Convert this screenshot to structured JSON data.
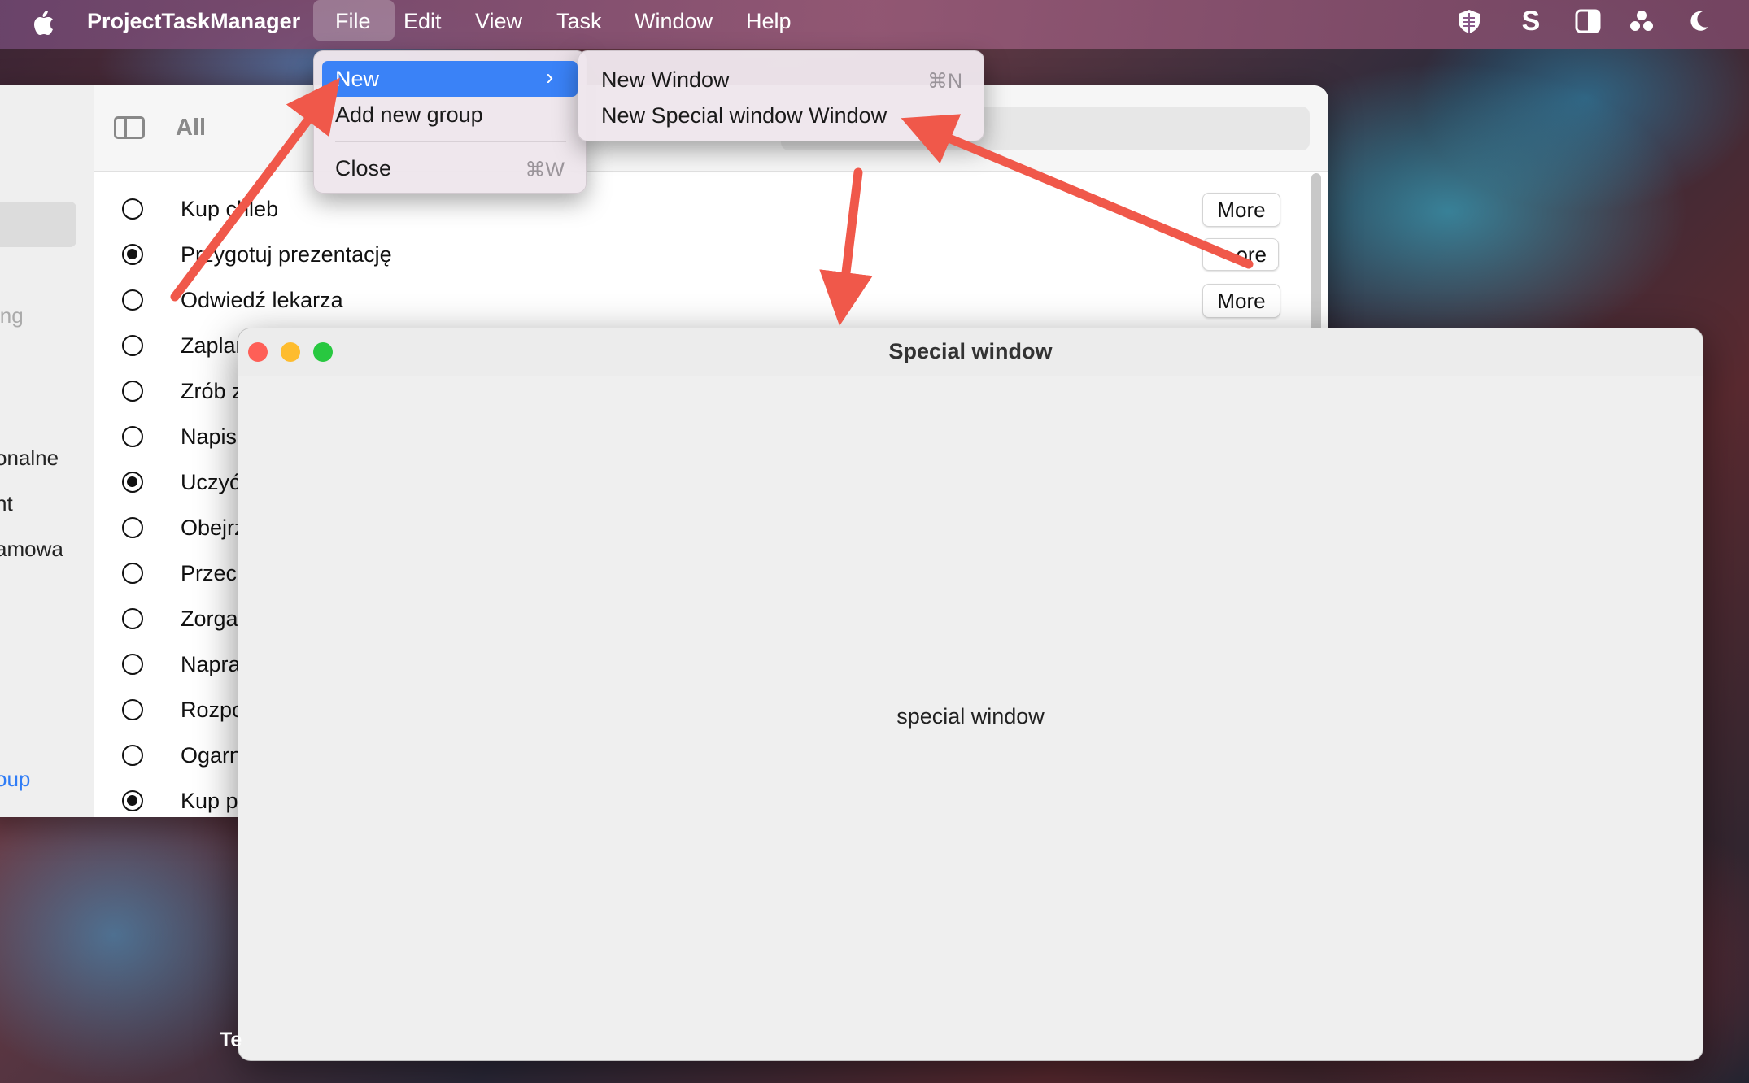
{
  "menubar": {
    "app_name": "ProjectTaskManager",
    "items": [
      "File",
      "Edit",
      "View",
      "Task",
      "Window",
      "Help"
    ],
    "status_icons": [
      "vpn-shield-icon",
      "s-app-icon",
      "sidebar-app-icon",
      "dots-app-icon",
      "moon-icon"
    ]
  },
  "main_window": {
    "toolbar_title": "All",
    "sidebar_fragments": [
      "ing",
      "onalne",
      "nt",
      "amowa",
      "oup"
    ],
    "tasks": [
      {
        "label": "Kup chleb",
        "checked": false
      },
      {
        "label": "Przygotuj prezentację",
        "checked": true
      },
      {
        "label": "Odwiedź lekarza",
        "checked": false
      },
      {
        "label": "Zaplan",
        "checked": false
      },
      {
        "label": "Zrób za",
        "checked": false
      },
      {
        "label": "Napisz",
        "checked": false
      },
      {
        "label": "Uczyć",
        "checked": true
      },
      {
        "label": "Obejrz",
        "checked": false
      },
      {
        "label": "Przecz",
        "checked": false
      },
      {
        "label": "Zorgan",
        "checked": false
      },
      {
        "label": "Napraw",
        "checked": false
      },
      {
        "label": "Rozpoc",
        "checked": false
      },
      {
        "label": "Ogarni",
        "checked": false
      },
      {
        "label": "Kup pr",
        "checked": true
      }
    ],
    "more_label": "More",
    "more_partial_label": "ore"
  },
  "file_menu": {
    "new_label": "New",
    "add_group_label": "Add new group",
    "close_label": "Close",
    "close_shortcut": "⌘W"
  },
  "new_submenu": {
    "new_window_label": "New Window",
    "new_window_shortcut": "⌘N",
    "new_special_label": "New Special window Window"
  },
  "special_window": {
    "title": "Special window",
    "body_text": "special window"
  },
  "desktop": {
    "partial_label": "Te"
  },
  "colors": {
    "arrow": "#f0584a",
    "highlight": "#3a82f7",
    "close": "#fe5f57",
    "minimize": "#febc2e",
    "zoom": "#28c840"
  }
}
